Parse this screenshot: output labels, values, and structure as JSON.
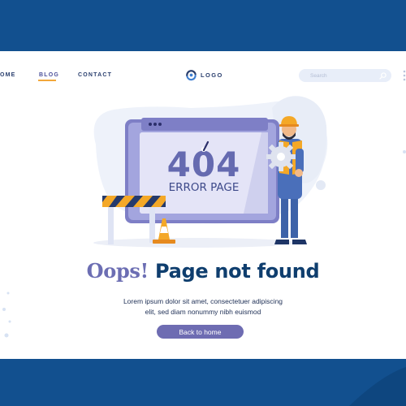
{
  "nav": {
    "items": [
      {
        "label": "OME",
        "active": false
      },
      {
        "label": "BLOG",
        "active": true
      },
      {
        "label": "CONTACT",
        "active": false
      }
    ]
  },
  "logo": {
    "text": "LOGO"
  },
  "search": {
    "placeholder": "Search",
    "icon": "search-icon"
  },
  "illustration": {
    "code": "404",
    "label": "ERROR PAGE"
  },
  "hero": {
    "title_accent": "Oops!",
    "title_rest": "Page not found",
    "description_line1": "Lorem ipsum dolor sit amet, consectetuer adipiscing",
    "description_line2": "elit, sed diam nonummy nibh euismod",
    "button_label": "Back to home"
  },
  "colors": {
    "frame": "#12508f",
    "page_background": "#ffffff",
    "heading": "#0f3e6e",
    "accent": "#6e6cb2",
    "underline": "#f2a73b"
  }
}
